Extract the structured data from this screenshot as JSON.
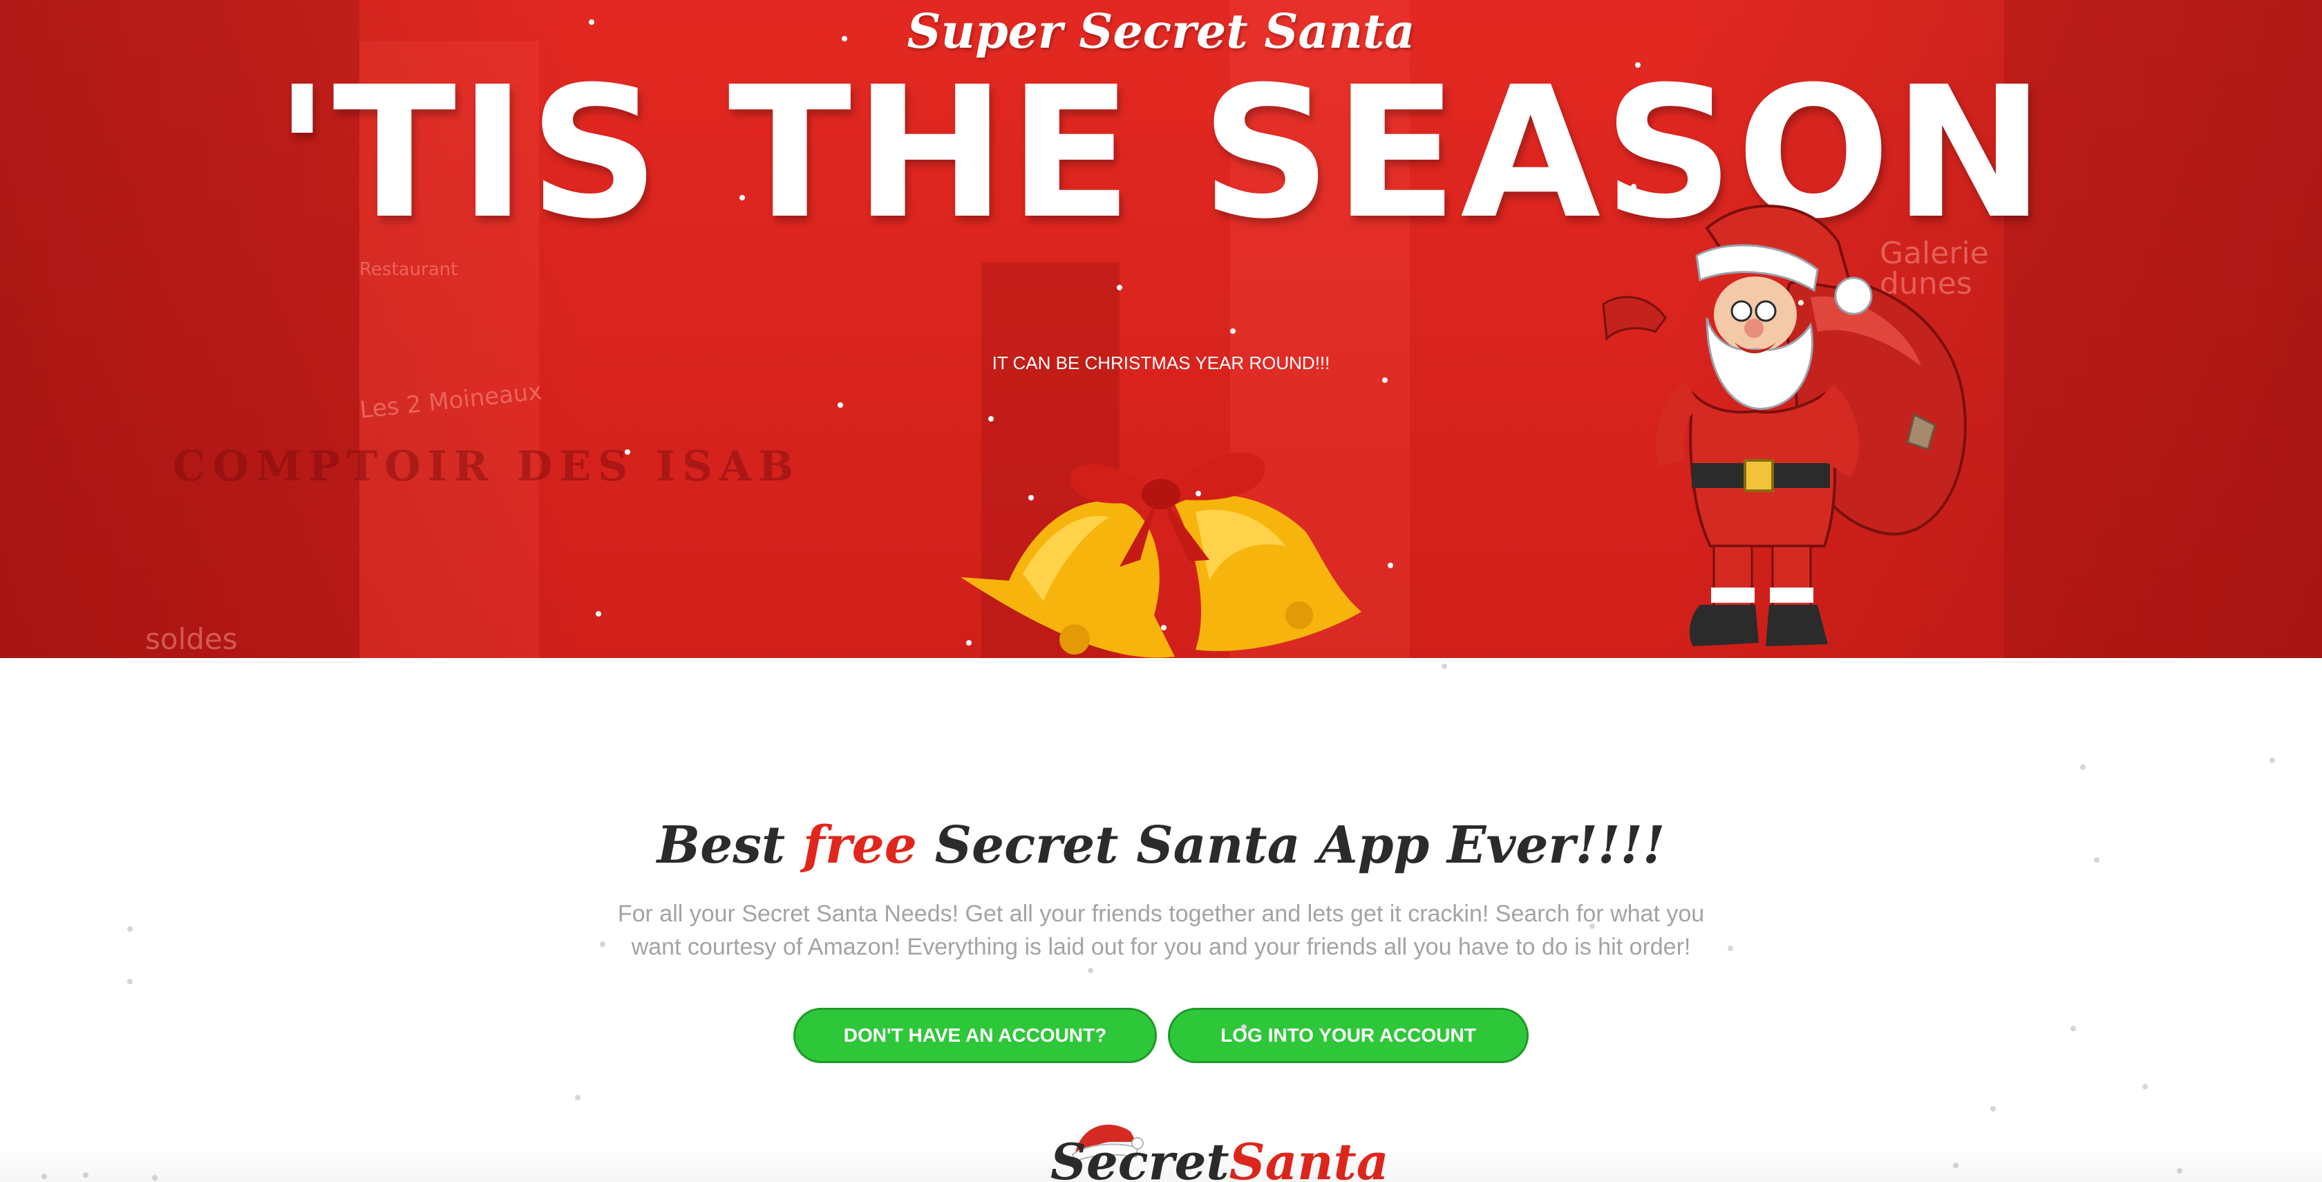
{
  "hero": {
    "site_name": "Super Secret Santa",
    "title": "'TIS THE SEASON",
    "tagline": "IT CAN BE CHRISTMAS YEAR ROUND!!!",
    "background_color": "#d9221c",
    "signs": {
      "left_shop": "COMPTOIR DES ISAB",
      "left_small": "Les 2 Moineaux",
      "restaurant": "Restaurant",
      "soldes": "soldes",
      "right_shop": "Galerie dunes"
    }
  },
  "content": {
    "heading_before": "Best ",
    "heading_highlight": "free",
    "heading_after": " Secret Santa App Ever!!!!",
    "description": "For all your Secret Santa Needs! Get all your friends together and lets get it crackin! Search for what you want courtesy of Amazon! Everything is laid out for you and your friends all you have to do is hit order!",
    "buttons": {
      "signup_label": "DON'T HAVE AN ACCOUNT?",
      "login_label": "LOG INTO YOUR ACCOUNT"
    }
  },
  "logo": {
    "part1": "Secret",
    "part2": "Santa"
  },
  "colors": {
    "accent_red": "#e0261d",
    "button_green": "#2ec73a",
    "text_dark": "#2b2b2b",
    "text_grey": "#a3a3a3"
  },
  "icons": [
    "bells-icon",
    "santa-icon",
    "santa-hat-icon"
  ]
}
